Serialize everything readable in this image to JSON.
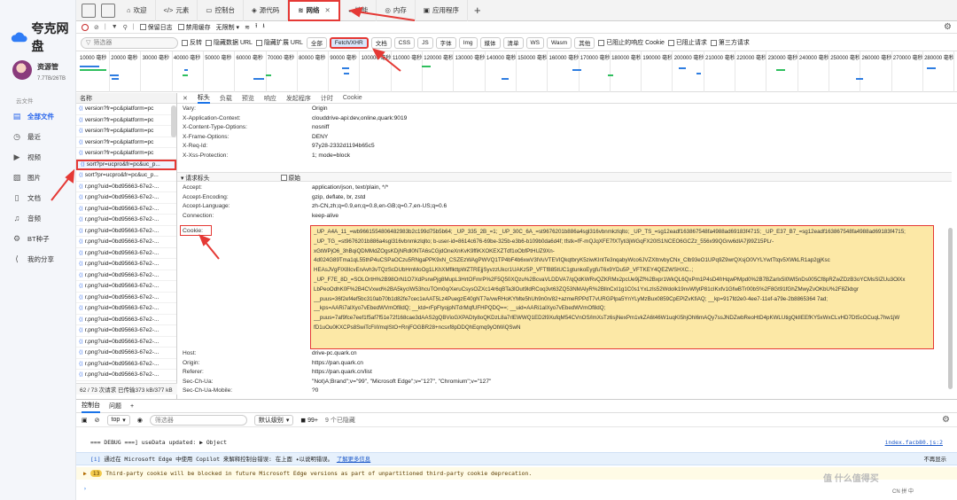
{
  "app": {
    "name": "夸克网盘",
    "user": "资源管",
    "quota": "7.7TB/26TB",
    "section": "云文件",
    "nav": [
      {
        "icon": "folder-icon",
        "glyph": "▤",
        "label": "全部文件",
        "active": true
      },
      {
        "icon": "clock-icon",
        "glyph": "◷",
        "label": "最近"
      },
      {
        "icon": "video-icon",
        "glyph": "▶",
        "label": "视频"
      },
      {
        "icon": "image-icon",
        "glyph": "▨",
        "label": "图片"
      },
      {
        "icon": "document-icon",
        "glyph": "▯",
        "label": "文档"
      },
      {
        "icon": "headphones-icon",
        "glyph": "♫",
        "label": "音频"
      },
      {
        "icon": "bt-icon",
        "glyph": "⚙",
        "label": "BT种子"
      },
      {
        "icon": "share-icon",
        "glyph": "⟨",
        "label": "我的分享"
      }
    ]
  },
  "devtools": {
    "tabs": [
      {
        "icon": "welcome-icon",
        "glyph": "⌂",
        "label": "欢迎"
      },
      {
        "icon": "elements-icon",
        "glyph": "</>",
        "label": "元素"
      },
      {
        "icon": "console-icon",
        "glyph": "▭",
        "label": "控制台"
      },
      {
        "icon": "sources-icon",
        "glyph": "◈",
        "label": "源代码"
      },
      {
        "icon": "wifi-icon",
        "glyph": "≋",
        "label": "网络",
        "active": true
      },
      {
        "icon": "performance-icon",
        "glyph": "◒",
        "label": "性能"
      },
      {
        "icon": "memory-icon",
        "glyph": "◎",
        "label": "内存"
      },
      {
        "icon": "application-icon",
        "glyph": "▣",
        "label": "应用程序"
      }
    ],
    "toolbar": {
      "preserve_log": "保留日志",
      "disable_cache": "禁用缓存",
      "throttle": "无限制"
    },
    "filter": {
      "placeholder": "筛选器",
      "invert": "反转",
      "hide_data_urls": "隐藏数据 URL",
      "hide_ext_urls": "隐藏扩展 URL",
      "types": [
        "全部",
        "Fetch/XHR",
        "文档",
        "CSS",
        "JS",
        "字体",
        "Img",
        "媒体",
        "清单",
        "WS",
        "Wasm",
        "其他"
      ],
      "active_type": "Fetch/XHR",
      "blocked_cookies": "已阻止的响应 Cookie",
      "blocked_requests": "已阻止请求",
      "third_party": "第三方请求"
    },
    "timeline": {
      "ticks": [
        "10000 毫秒",
        "20000 毫秒",
        "30000 毫秒",
        "40000 毫秒",
        "50000 毫秒",
        "60000 毫秒",
        "70000 毫秒",
        "80000 毫秒",
        "90000 毫秒",
        "100000 毫秒",
        "110000 毫秒",
        "120000 毫秒",
        "130000 毫秒",
        "140000 毫秒",
        "150000 毫秒",
        "160000 毫秒",
        "170000 毫秒",
        "180000 毫秒",
        "190000 毫秒",
        "200000 毫秒",
        "210000 毫秒",
        "220000 毫秒",
        "230000 毫秒",
        "240000 毫秒",
        "250000 毫秒",
        "260000 毫秒",
        "270000 毫秒",
        "280000 毫秒"
      ]
    },
    "requests": {
      "header": "名称",
      "items": [
        "version?fr=pc&platform=pc",
        "version?fr=pc&platform=pc",
        "version?fr=pc&platform=pc",
        "version?fr=pc&platform=pc",
        "version?fr=pc&platform=pc",
        "sort?pr=ucpro&fr=pc&uc_p...",
        "sort?pr=ucpro&fr=pc&uc_p...",
        "r.png?uid=0bd95663-67e2-...",
        "r.png?uid=0bd95663-67e2-...",
        "r.png?uid=0bd95663-67e2-...",
        "r.png?uid=0bd95663-67e2-...",
        "r.png?uid=0bd95663-67e2-...",
        "r.png?uid=0bd95663-67e2-...",
        "r.png?uid=0bd95663-67e2-...",
        "r.png?uid=0bd95663-67e2-...",
        "r.png?uid=0bd95663-67e2-...",
        "r.png?uid=0bd95663-67e2-...",
        "r.png?uid=0bd95663-67e2-...",
        "r.png?uid=0bd95663-67e2-...",
        "r.png?uid=0bd95663-67e2-...",
        "r.png?uid=0bd95663-67e2-...",
        "r.png?uid=0bd95663-67e2-...",
        "r.png?uid=0bd95663-67e2-...",
        "r.png?uid=0bd95663-67e2-...",
        "r.png?uid=0bd95663-67e2-...",
        "r.png?uid=0bd95663-67e2-..."
      ],
      "selected": 5,
      "status": "62 / 73 次请求   已传输373 kB/377 kB"
    },
    "detail": {
      "tabs": [
        "标头",
        "负载",
        "预览",
        "响应",
        "发起程序",
        "计时",
        "Cookie"
      ],
      "active_tab": "标头",
      "resp_headers": [
        {
          "k": "Vary:",
          "v": "Origin"
        },
        {
          "k": "X-Application-Context:",
          "v": "clouddrive-api:dev,online,quark:9019"
        },
        {
          "k": "X-Content-Type-Options:",
          "v": "nosniff"
        },
        {
          "k": "X-Frame-Options:",
          "v": "DENY"
        },
        {
          "k": "X-Req-Id:",
          "v": "97y28-2332d1194b65c5"
        },
        {
          "k": "X-Xss-Protection:",
          "v": "1; mode=block"
        }
      ],
      "req_section": "▾ 请求标头",
      "raw": "原始",
      "req_headers": [
        {
          "k": "Accept:",
          "v": "application/json, text/plain, */*"
        },
        {
          "k": "Accept-Encoding:",
          "v": "gzip, deflate, br, zstd"
        },
        {
          "k": "Accept-Language:",
          "v": "zh-CN,zh;q=0.9,en;q=0.8,en-GB;q=0.7,en-US;q=0.6"
        },
        {
          "k": "Connection:",
          "v": "keep-alive"
        }
      ],
      "cookie_key": "Cookie:",
      "cookie_lines": [
        "_UP_A4A_11_=wb9661554806482983b2c199d75b5b64; _UP_335_2B_=1; _UP_30C_6A_=st9676201b886a4sgl316vbnmkzlqlto; _UP_TS_=sg12eadf163867548fa4988ad69183f4715; _UP_E37_B7_=sg12eadf163867548fa4988ad69183f4715;",
        "_UP_TG_=st9676201b886a4sgl316vbnmkzlqlto; b-user-id=8614c676-69be-325b-e3b6-b109b0da6d4f; tfstk=fF-mQJqXFE7fXTyti3jWGqFX20lS1NCEO6GCZz_556x99QGrw6dlA7j99Z15PLr-",
        "xGtWPjO6_3hBqiQDMMdZOgsKDjNRdl0NTA6sCGjdOneXnKvK9ffiKXOKEXZTdf1oObfPtHUZ9Xn-",
        "4d024G89Tma1qL55thP4uCSPaOCzu5RNgaPPK9xN_CSZEzWAgPWVQ1TP4bF4b6xwV3lVuVTEVIQkqtbryK5ziwKIntTe3nqabyWco6JVZXltnvbyCNx_Clb93eO1UPq9Z9wrQXsjO0VYLYwtTtqv5XWkLR1ap2gjKsc",
        "HEAsJVgFIX8IcvEnAvh3vTQzScDUbHmMoOg1LKhXMflkttpWZTREjjSyvzzUkcr1UAKz5P_VFTf885tUC1gtunkoEygfuT6x9YDu5P_VFTKEY4QEZWSHXC..;",
        "_UP_F7E_8D_=SOLOrtH%2B98OrN1O7XdPsrwPjg8MupL3HrtOFmrP%2F5Q50XQzu%2BcvaVLDDVA7/qQdKWRvQZKRMx2pcUe9jZf%2Bxpr1WkQL6QxPm1P4sD4frHqwPMpd0%2B7BZarlx5l0Wl5nDs005Cf8pRZwZDzB3oYCMsSIZUu3OlXx",
        "LbPeoOdhK0F%2B4CVxwd%2BA5kycIW53hcuTOm0q/XeruCsysOZXc14r6qBTa3lOut9ldRCoq3vt63ZQ53NMAlyR%2BllnCxI1g1C0s1YxLzIs52Wdolk19nvWfytP81cIKxfv1GfwBTr00bS%2F8Gt91fGhZMwyZvOKbU%2F8Zkbgr",
        "__puus=36f2ef4ef5bc310ab70b1d82fe7cec1eAAT5Lz4PuegzE40gNT7e/vwRHoKYMte5hUh9n0n/82+azmeRPPdT7vURGPlpa5YnYLyMzBux0859CpEPlZvKfiAQ; __kp=917fd2e0-4ee7-11ef-a79e-2b8865364 7ad;",
        "__kps=AARi7alXyo7vEbedWVmOf8dQ; __ktd=rFpFtyojpNTdrMqfUFHPQDQ==; __uid=AARi1alXyo7vEbedWVmOf8dQ;",
        "__puus=7af9fce7eef1f5af7f51e72f168cae3dAAS2gQBVioGXPADty8oQKDzL8a7rlEWWQ1ED2l9XufqM54CVnOS/lmXsTz6sjNexPm1vkZA6t46W1uqKI5hjOhl6mAQy7ssJNDZwbReoHtD4pKWLUtigQklIEEfKY5xWxCLvHD7Dt5cOCuqL7hw1jW",
        "fD1uOu0KXCPs8SwiTcFI/l/mqlStO+RnjFOGBR28+ncsxf8pDDQhEqmq9yOtWiQSwN"
      ],
      "more_headers": [
        {
          "k": "Host:",
          "v": "drive-pc.quark.cn"
        },
        {
          "k": "Origin:",
          "v": "https://pan.quark.cn"
        },
        {
          "k": "Referer:",
          "v": "https://pan.quark.cn/list"
        },
        {
          "k": "Sec-Ch-Ua:",
          "v": "\"Not)A;Brand\";v=\"99\", \"Microsoft Edge\";v=\"127\", \"Chromium\";v=\"127\""
        },
        {
          "k": "Sec-Ch-Ua-Mobile:",
          "v": "?0"
        }
      ]
    },
    "drawer": {
      "tabs": [
        "控制台",
        "问题"
      ],
      "active": "控制台",
      "context": "top",
      "filter_placeholder": "筛选器",
      "levels": "默认级别",
      "issues": "99+",
      "hidden": "9 个已隐藏",
      "msg1": "=== DEBUG ===] useData updated:",
      "msg1_obj": "▶ Object",
      "msg1_src": "index.facb80.js:2",
      "copilot_tag": "[i]",
      "copilot_text": "通过在 Microsoft Edge 中使用 Copilot 来解释控制台错误: 在上面",
      "copilot_icon_text": "以说明错误。",
      "copilot_link": "了解更多信息",
      "copilot_dismiss": "不再显示",
      "warn_count": "13",
      "warn_text": "Third-party cookie will be blocked in future Microsoft Edge versions as part of unpartitioned third-party cookie deprecation."
    },
    "watermark": "值 什么值得买",
    "tray": "CN 拼 中"
  },
  "colors": {
    "accent": "#1a73e8",
    "highlight": "#e53935",
    "cookie_bg": "#fce8a6",
    "brand": "#2563eb"
  }
}
